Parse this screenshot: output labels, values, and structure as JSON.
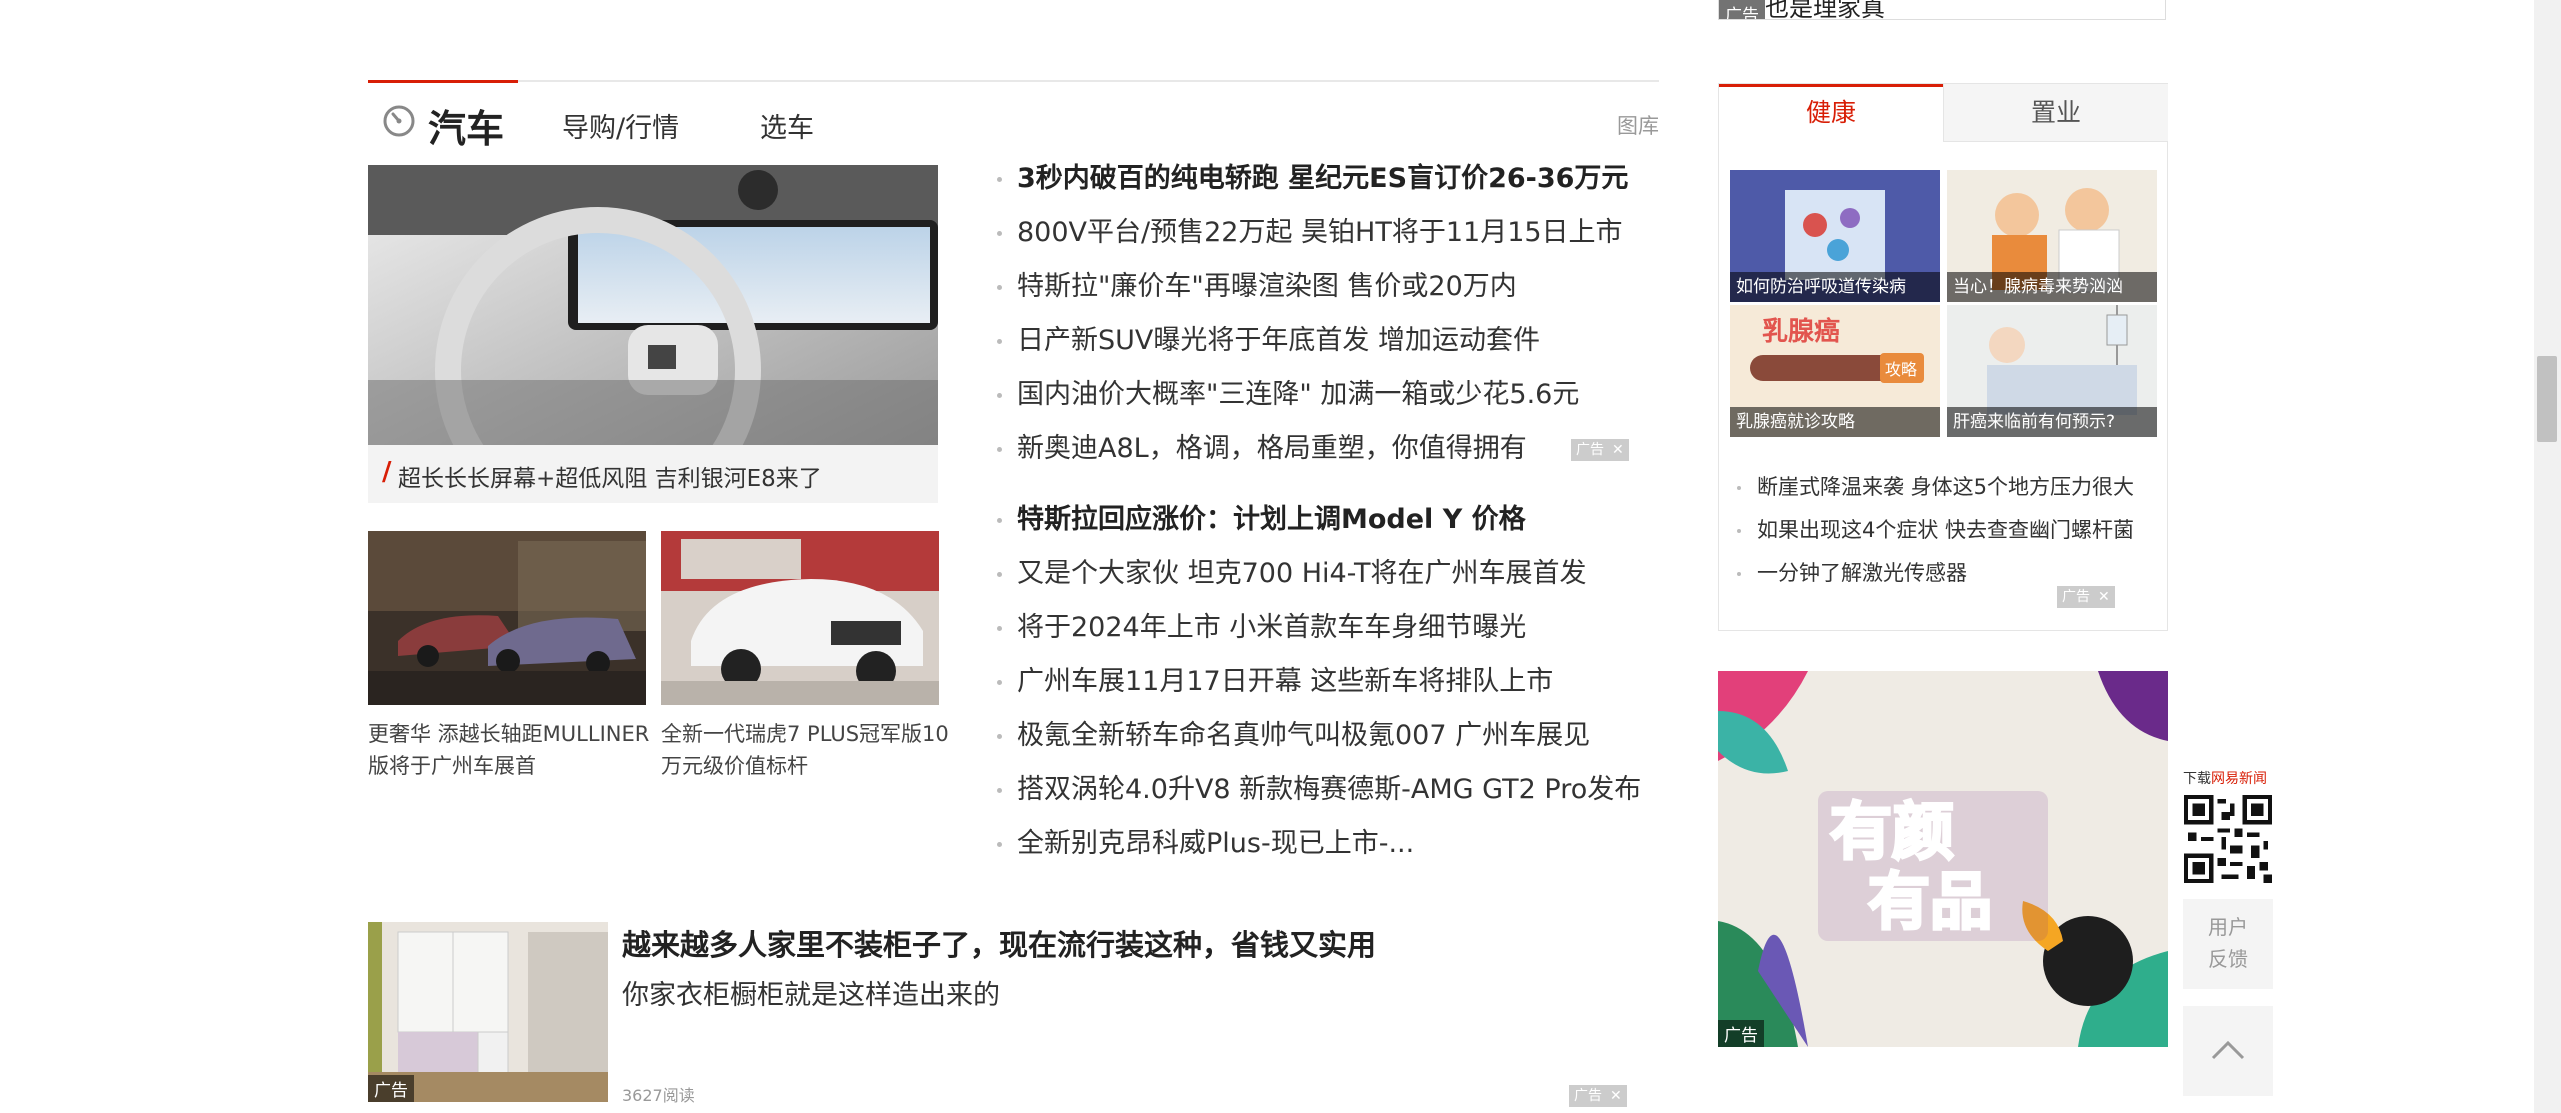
{
  "top_ad": {
    "text": "也是理家真",
    "tag": "广告"
  },
  "car_section": {
    "title": "汽车",
    "nav": [
      "导购/行情",
      "选车"
    ],
    "gallery": "图库",
    "main_caption": "超长长长屏幕+超低风阻 吉利银河E8来了",
    "thumbs": [
      {
        "caption": "更奢华 添越长轴距MULLINER版将于广州车展首"
      },
      {
        "caption": "全新一代瑞虎7 PLUS冠军版10万元级价值标杆"
      }
    ],
    "list1": [
      {
        "text": "3秒内破百的纯电轿跑 星纪元ES盲订价26-36万元",
        "bold": true
      },
      {
        "text": "800V平台/预售22万起 昊铂HT将于11月15日上市"
      },
      {
        "text": "特斯拉\"廉价车\"再曝渲染图 售价或20万内"
      },
      {
        "text": "日产新SUV曝光将于年底首发 增加运动套件"
      },
      {
        "text": "国内油价大概率\"三连降\" 加满一箱或少花5.6元"
      },
      {
        "text": "新奥迪A8L，格调，格局重塑，你值得拥有"
      }
    ],
    "list2": [
      {
        "text": "特斯拉回应涨价：计划上调Model Y 价格",
        "bold": true
      },
      {
        "text": "又是个大家伙 坦克700 Hi4-T将在广州车展首发"
      },
      {
        "text": "将于2024年上市 小米首款车车身细节曝光"
      },
      {
        "text": "广州车展11月17日开幕 这些新车将排队上市"
      },
      {
        "text": "极氪全新轿车命名真帅气叫极氪007 广州车展见"
      },
      {
        "text": "搭双涡轮4.0升V8 新款梅赛德斯-AMG GT2 Pro发布"
      },
      {
        "text": "全新别克昂科威Plus-现已上市-..."
      }
    ],
    "ad_label": "广告"
  },
  "feed_item": {
    "title": "越来越多人家里不装柜子了，现在流行装这种，省钱又实用",
    "subtitle": "你家衣柜橱柜就是这样造出来的",
    "reads": "3627阅读",
    "tag": "广告"
  },
  "health_panel": {
    "tabs": [
      "健康",
      "置业"
    ],
    "tiles": [
      {
        "caption": "如何防治呼吸道传染病"
      },
      {
        "caption": "当心！腺病毒来势汹汹"
      },
      {
        "caption": "乳腺癌就诊攻略"
      },
      {
        "caption": "肝癌来临前有何预示?"
      }
    ],
    "tile3_banner": "乳腺癌",
    "tile3_badge": "攻略",
    "links": [
      "断崖式降温来袭 身体这5个地方压力很大",
      "如果出现这4个症状 快去查查幽门螺杆菌",
      "一分钟了解激光传感器"
    ],
    "ad_label": "广告"
  },
  "promo": {
    "line1": "有颜",
    "line2": "有品",
    "tag": "广告"
  },
  "side_tools": {
    "qr_prefix": "下载",
    "qr_brand": "网易新闻",
    "feedback": [
      "用户",
      "反馈"
    ]
  },
  "colors": {
    "accent": "#d81e06",
    "text": "#333333",
    "muted": "#999999"
  }
}
